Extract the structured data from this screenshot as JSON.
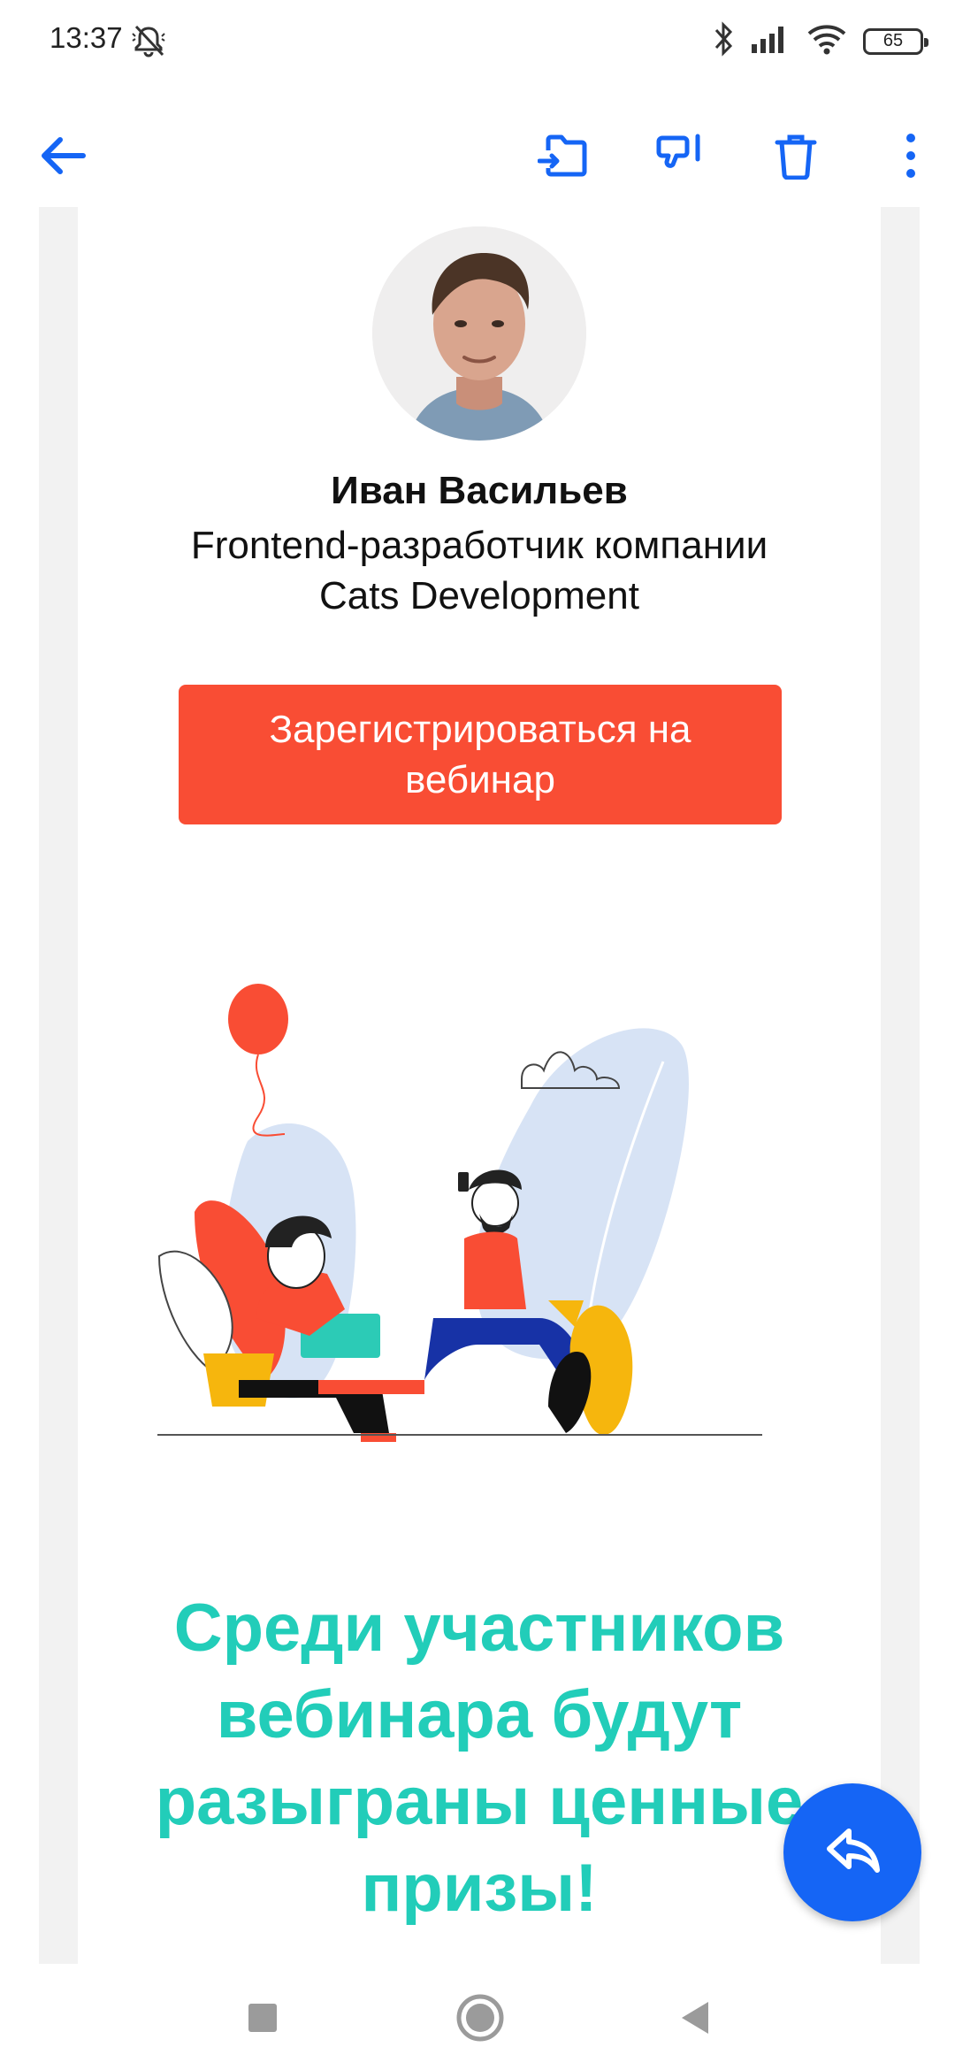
{
  "status_bar": {
    "time": "13:37",
    "battery_level": "65",
    "icons": [
      "mute-alarm-icon",
      "bluetooth-icon",
      "signal-icon",
      "wifi-icon",
      "battery-icon"
    ]
  },
  "toolbar": {
    "icons": [
      "back-arrow-icon",
      "move-to-folder-icon",
      "spam-icon",
      "trash-icon",
      "more-vert-icon"
    ],
    "accent_color": "#1565f5"
  },
  "email": {
    "speaker": {
      "name": "Иван Васильев",
      "role_line1": "Frontend-разработчик компании",
      "role_line2": "Cats Development"
    },
    "cta_label": "Зарегистрироваться на вебинар",
    "cta_color": "#f94d34",
    "prize_headline": "Среди участников вебинара будут разыграны ценные призы!",
    "headline_color": "#22cdb9"
  },
  "fab": {
    "icon": "reply-icon"
  },
  "nav_bar": {
    "icons": [
      "recents-square-icon",
      "home-circle-icon",
      "back-triangle-icon"
    ]
  }
}
